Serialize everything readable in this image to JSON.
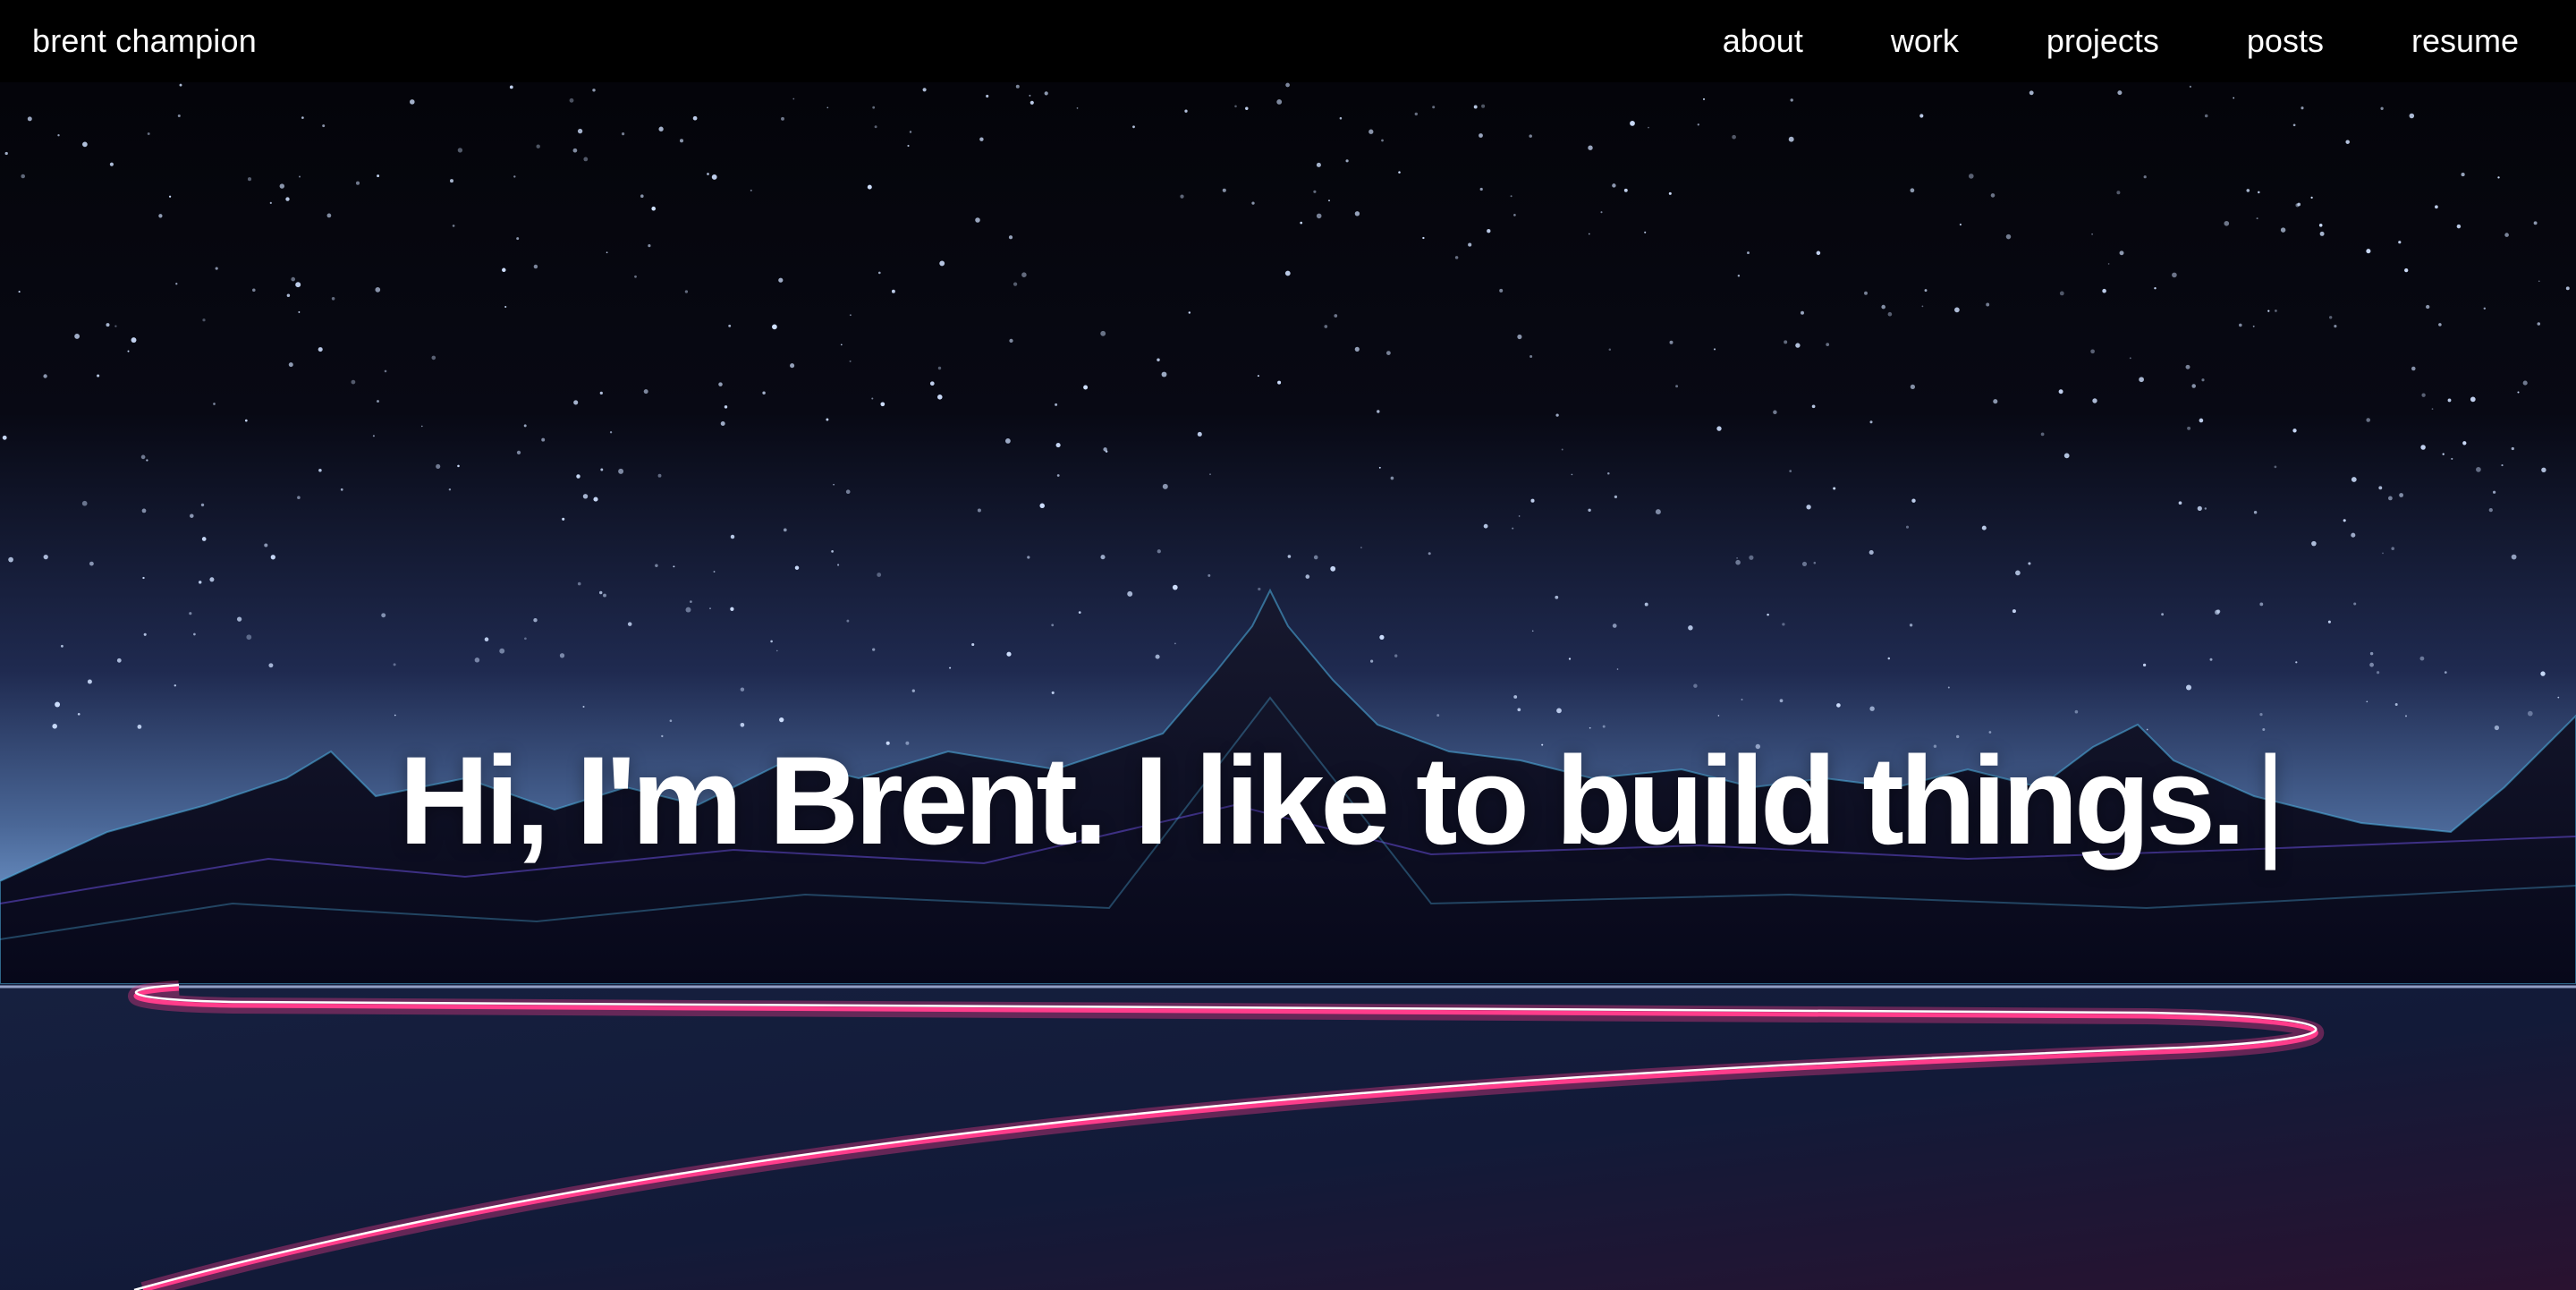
{
  "header": {
    "brand": "brent champion",
    "nav": [
      {
        "label": "about"
      },
      {
        "label": "work"
      },
      {
        "label": "projects"
      },
      {
        "label": "posts"
      },
      {
        "label": "resume"
      }
    ]
  },
  "hero": {
    "headline": "Hi, I'm Brent. I like to build things.",
    "cursor": "|"
  },
  "colors": {
    "background": "#05050a",
    "nav_background": "#000000",
    "text": "#ffffff",
    "light_trail_pink": "#ff3d8b",
    "mountain_glow": "#6aa6e8"
  }
}
